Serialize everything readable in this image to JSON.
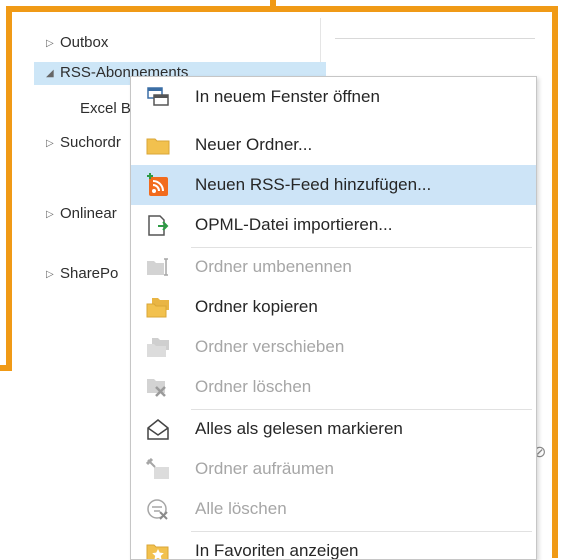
{
  "folders": [
    {
      "label": "Outbox",
      "arrow": "▷"
    },
    {
      "label": "RSS-Abonnements",
      "arrow": "◢"
    },
    {
      "label": "Excel B",
      "arrow": ""
    },
    {
      "label": "Suchordr",
      "arrow": "▷"
    },
    {
      "label": "Onlinear",
      "arrow": "▷"
    },
    {
      "label": "SharePo",
      "arrow": "▷"
    }
  ],
  "context_menu": {
    "items": [
      {
        "label": "In neuem Fenster öffnen",
        "icon": "new-window-icon",
        "enabled": true
      },
      {
        "label": "Neuer Ordner...",
        "icon": "folder-icon",
        "enabled": true
      },
      {
        "label": "Neuen RSS-Feed hinzufügen...",
        "icon": "rss-add-icon",
        "enabled": true,
        "highlighted": true
      },
      {
        "label": "OPML-Datei importieren...",
        "icon": "import-icon",
        "enabled": true
      },
      {
        "label": "Ordner umbenennen",
        "icon": "rename-folder-icon",
        "enabled": false
      },
      {
        "label": "Ordner kopieren",
        "icon": "copy-folder-icon",
        "enabled": true
      },
      {
        "label": "Ordner verschieben",
        "icon": "move-folder-icon",
        "enabled": false
      },
      {
        "label": "Ordner löschen",
        "icon": "delete-folder-icon",
        "enabled": false
      },
      {
        "label": "Alles als gelesen markieren",
        "icon": "mark-read-icon",
        "enabled": true
      },
      {
        "label": "Ordner aufräumen",
        "icon": "cleanup-icon",
        "enabled": false
      },
      {
        "label": "Alle löschen",
        "icon": "delete-all-icon",
        "enabled": false
      },
      {
        "label": "In Favoriten anzeigen",
        "icon": "favorites-icon",
        "enabled": true
      }
    ]
  },
  "colors": {
    "frame": "#f09a16",
    "highlight": "#cde4f7",
    "rss_orange": "#f26b1d",
    "folder_yellow": "#f2c14e"
  }
}
